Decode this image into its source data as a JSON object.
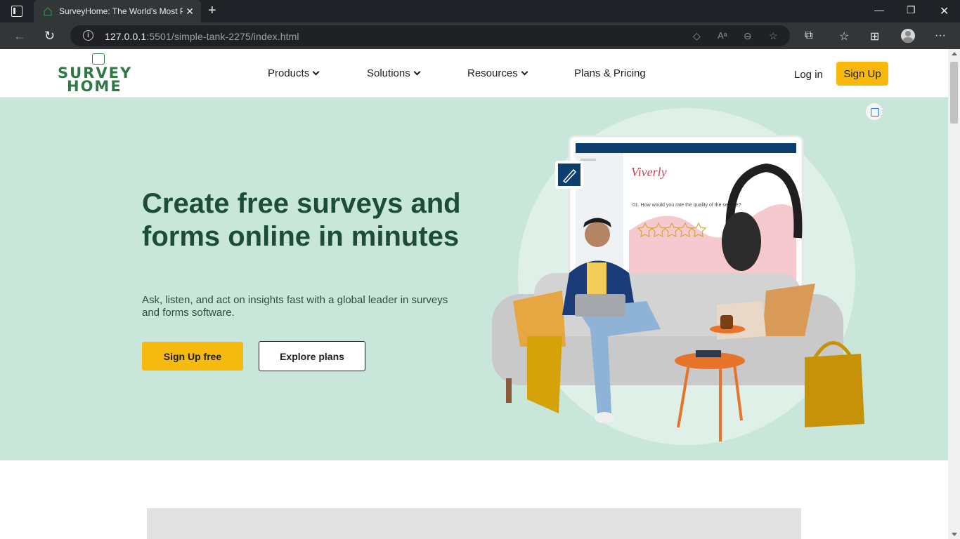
{
  "browser": {
    "tab_title": "SurveyHome: The World's Most P",
    "url_host": "127.0.0.1",
    "url_rest": ":5501/simple-tank-2275/index.html"
  },
  "site": {
    "logo_line1": "SURVEY",
    "logo_line2": "HOME",
    "nav": [
      {
        "label": "Products"
      },
      {
        "label": "Solutions"
      },
      {
        "label": "Resources"
      },
      {
        "label": "Plans & Pricing"
      }
    ],
    "login_label": "Log in",
    "signup_label": "Sign Up"
  },
  "hero": {
    "heading": "Create free surveys and forms online in minutes",
    "subheading": "Ask, listen, and act on insights fast with a global leader in surveys and forms software.",
    "primary_cta": "Sign Up free",
    "secondary_cta": "Explore plans",
    "mock_brand": "Viverly",
    "mock_question": "01. How would you rate the quality of the service?",
    "mock_rating_stars": 5
  },
  "colors": {
    "brand_green": "#2f7a44",
    "hero_bg": "#c8e7da",
    "heading_green": "#1e4d36",
    "cta_yellow": "#f6b90d"
  }
}
